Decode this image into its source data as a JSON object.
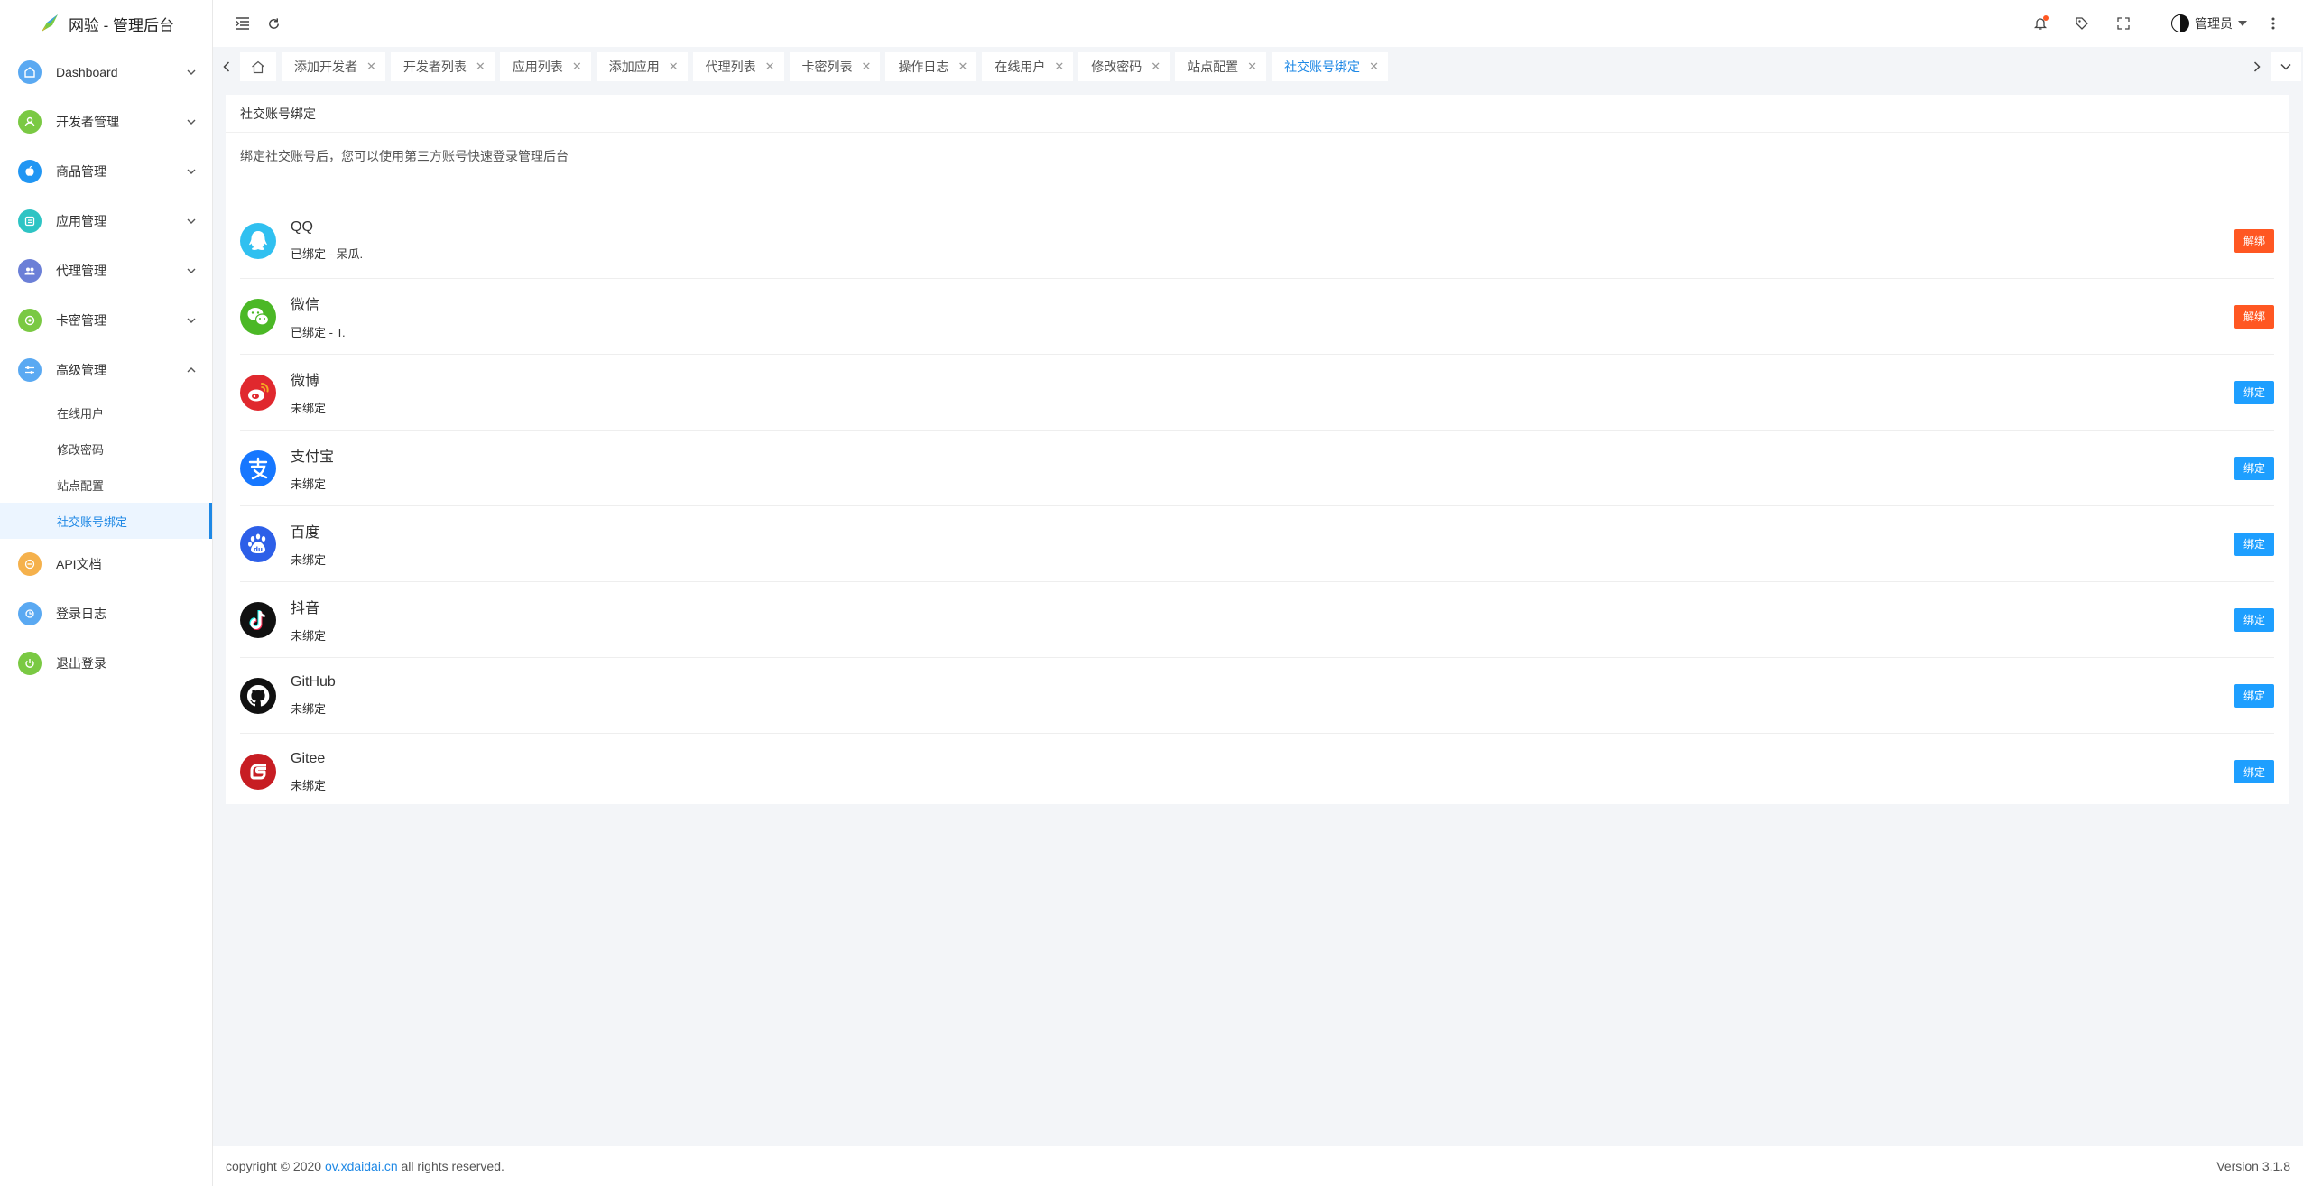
{
  "app": {
    "title": "网验 - 管理后台"
  },
  "sidebar": {
    "items": [
      {
        "label": "Dashboard",
        "color": "#5aa9f2",
        "icon": "home-icon",
        "expanded": false
      },
      {
        "label": "开发者管理",
        "color": "#7ac943",
        "icon": "user-icon",
        "expanded": false
      },
      {
        "label": "商品管理",
        "color": "#2196f3",
        "icon": "apple-icon",
        "expanded": false
      },
      {
        "label": "应用管理",
        "color": "#2ec4c4",
        "icon": "app-icon",
        "expanded": false
      },
      {
        "label": "代理管理",
        "color": "#6b7fd7",
        "icon": "group-icon",
        "expanded": false
      },
      {
        "label": "卡密管理",
        "color": "#7ac943",
        "icon": "card-icon",
        "expanded": false
      },
      {
        "label": "高级管理",
        "color": "#5aa9f2",
        "icon": "sliders-icon",
        "expanded": true
      }
    ],
    "subitems": [
      "在线用户",
      "修改密码",
      "站点配置",
      "社交账号绑定"
    ],
    "bottom_items": [
      {
        "label": "API文档",
        "color": "#f5b14c",
        "icon": "doc-icon"
      },
      {
        "label": "登录日志",
        "color": "#5aa9f2",
        "icon": "log-icon"
      },
      {
        "label": "退出登录",
        "color": "#7ac943",
        "icon": "power-icon"
      }
    ]
  },
  "header": {
    "user_name": "管理员"
  },
  "tabs": [
    "添加开发者",
    "开发者列表",
    "应用列表",
    "添加应用",
    "代理列表",
    "卡密列表",
    "操作日志",
    "在线用户",
    "修改密码",
    "站点配置",
    "社交账号绑定"
  ],
  "active_tab": "社交账号绑定",
  "card": {
    "title": "社交账号绑定",
    "description": "绑定社交账号后，您可以使用第三方账号快速登录管理后台"
  },
  "accounts": [
    {
      "name": "QQ",
      "status": "已绑定 - 呆瓜.",
      "action": "解绑",
      "icon": "qq-icon",
      "color": "#30c0f0"
    },
    {
      "name": "微信",
      "status": "已绑定 - T.",
      "action": "解绑",
      "icon": "wechat-icon",
      "color": "#4bb826"
    },
    {
      "name": "微博",
      "status": "未绑定",
      "action": "绑定",
      "icon": "weibo-icon",
      "color": "#e0282e"
    },
    {
      "name": "支付宝",
      "status": "未绑定",
      "action": "绑定",
      "icon": "alipay-icon",
      "color": "#1677ff"
    },
    {
      "name": "百度",
      "status": "未绑定",
      "action": "绑定",
      "icon": "baidu-icon",
      "color": "#2d5fe8"
    },
    {
      "name": "抖音",
      "status": "未绑定",
      "action": "绑定",
      "icon": "douyin-icon",
      "color": "#111111"
    },
    {
      "name": "GitHub",
      "status": "未绑定",
      "action": "绑定",
      "icon": "github-icon",
      "color": "#111111"
    },
    {
      "name": "Gitee",
      "status": "未绑定",
      "action": "绑定",
      "icon": "gitee-icon",
      "color": "#c71d23"
    }
  ],
  "footer": {
    "prefix": "copyright © 2020 ",
    "link": "ov.xdaidai.cn",
    "suffix": " all rights reserved.",
    "version": "Version 3.1.8"
  }
}
